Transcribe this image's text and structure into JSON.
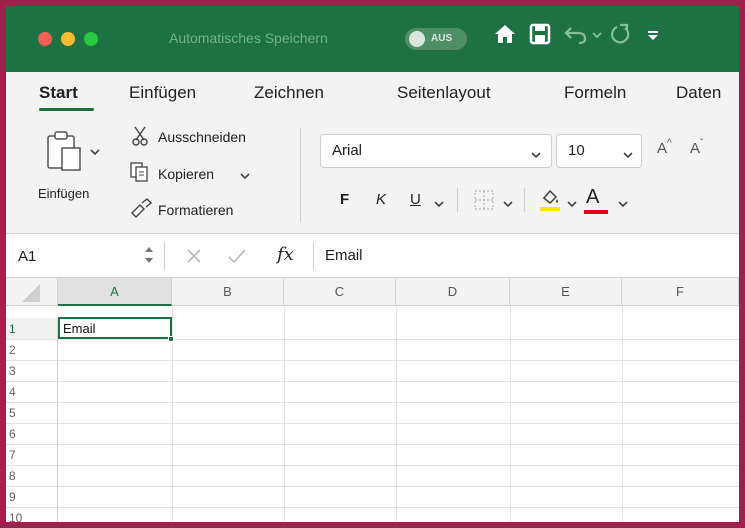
{
  "titlebar": {
    "autosave_label": "Automatisches Speichern",
    "autosave_state": "AUS",
    "icons": [
      "home-icon",
      "save-icon",
      "undo-icon",
      "redo-icon",
      "customize-icon"
    ]
  },
  "tabs": [
    {
      "label": "Start",
      "active": true
    },
    {
      "label": "Einfügen"
    },
    {
      "label": "Zeichnen"
    },
    {
      "label": "Seitenlayout"
    },
    {
      "label": "Formeln"
    },
    {
      "label": "Daten"
    }
  ],
  "ribbon": {
    "paste_label": "Einfügen",
    "cut_label": "Ausschneiden",
    "copy_label": "Kopieren",
    "format_painter_label": "Formatieren",
    "font_name": "Arial",
    "font_size": "10",
    "bold_label": "F",
    "italic_label": "K",
    "underline_label": "U",
    "font_color_label": "A",
    "grow_label": "A",
    "shrink_label": "A",
    "colors": {
      "highlight": "#ffe600",
      "font_color": "#e3001b"
    }
  },
  "formula_bar": {
    "name_box": "A1",
    "fx_label": "fx",
    "content": "Email"
  },
  "sheet": {
    "columns": [
      "A",
      "B",
      "C",
      "D",
      "E",
      "F"
    ],
    "rows": [
      "1",
      "2",
      "3",
      "4",
      "5",
      "6",
      "7",
      "8",
      "9",
      "10"
    ],
    "cells": {
      "A1": "Email"
    },
    "selected_cell": "A1"
  },
  "colors": {
    "accent": "#1e7145",
    "frame": "#a01f4c"
  }
}
